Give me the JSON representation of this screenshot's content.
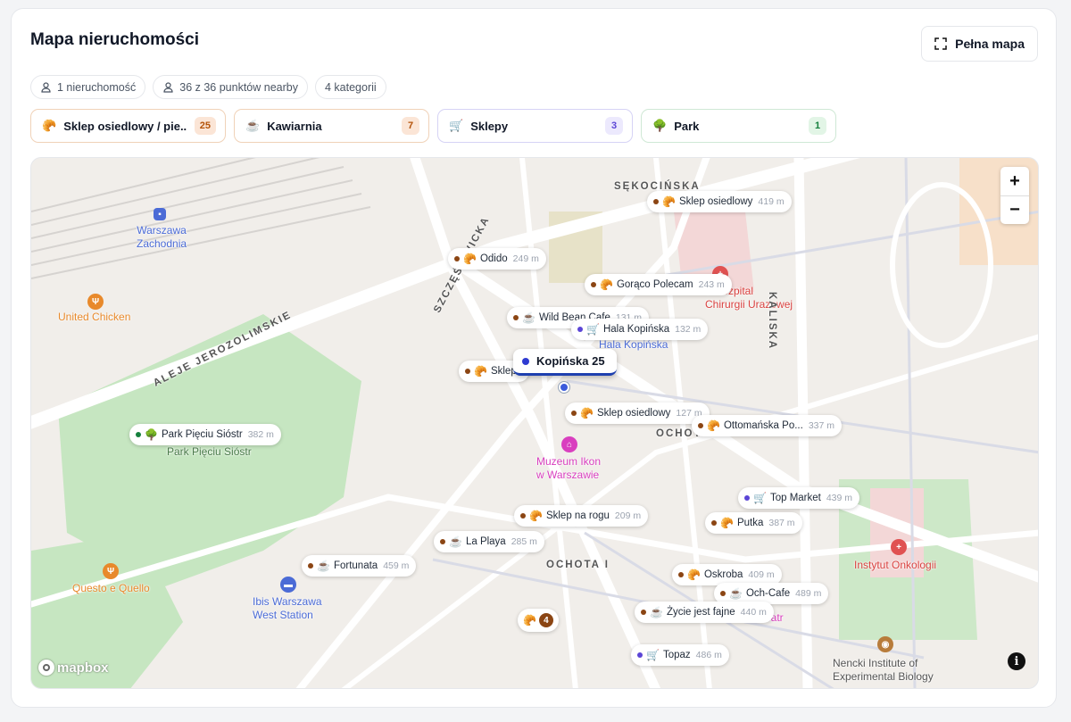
{
  "header": {
    "title": "Mapa nieruchomości",
    "full_map_label": "Pełna mapa",
    "full_map_icon": "expand-icon"
  },
  "pills": [
    {
      "icon": "person-pin-icon",
      "label": "1 nieruchomość"
    },
    {
      "icon": "person-pin-icon",
      "label": "36 z 36 punktów nearby"
    },
    {
      "label": "4 kategorii"
    }
  ],
  "categories": [
    {
      "icon": "🥐",
      "label": "Sklep osiedlowy / pie...",
      "count": "25",
      "border": "#f0d2b8",
      "badge_bg": "#fbe5d6",
      "badge_fg": "#b45309"
    },
    {
      "icon": "☕",
      "label": "Kawiarnia",
      "count": "7",
      "border": "#f0d2b8",
      "badge_bg": "#fbe5d6",
      "badge_fg": "#b45309"
    },
    {
      "icon": "🛒",
      "label": "Sklepy",
      "count": "3",
      "border": "#d6d3f5",
      "badge_bg": "#ece9fd",
      "badge_fg": "#5b45d6"
    },
    {
      "icon": "🌳",
      "label": "Park",
      "count": "1",
      "border": "#cfe8d5",
      "badge_bg": "#e2f5e6",
      "badge_fg": "#15803d"
    }
  ],
  "map": {
    "main_marker": "Kopińska 25",
    "cluster_count": "4",
    "cluster_icon": "🥐",
    "zoom_in": "+",
    "zoom_out": "−",
    "info": "i",
    "attribution": "mapbox",
    "places": [
      {
        "text": "Warszawa\nZachodnia",
        "color": "#4b6bd6"
      },
      {
        "text": "United Chicken",
        "color": "#e8892b"
      },
      {
        "text": "Park Pięciu Sióstr",
        "color": "#4a7a4a"
      },
      {
        "text": "Muzeum Ikon\nw Warszawie",
        "color": "#d93fbf"
      },
      {
        "text": "Questo e Quello",
        "color": "#e8892b"
      },
      {
        "text": "Ibis Warszawa\nWest Station",
        "color": "#4b6bd6"
      },
      {
        "text": "Instytut Onkologii",
        "color": "#d9413f"
      },
      {
        "text": "Nencki Institute of\nExperimental Biology",
        "color": "#555555"
      },
      {
        "text": "Hala Kopińska",
        "color": "#4b6bd6"
      },
      {
        "text": "cki Szpital\nChirurgii Urazowej",
        "color": "#d9413f"
      },
      {
        "text": "eatr",
        "color": "#d93fbf"
      }
    ],
    "streets": [
      "SĘKOCIŃSKA",
      "ALEJE JEROZOLIMSKIE",
      "SZCZĘŚLIWICKA",
      "KALISKA",
      "OCHOTA",
      "OCHOTA I"
    ],
    "markers": [
      {
        "icon": "🥐",
        "name": "Sklep osiedlowy",
        "dist": "419 m",
        "dot": "#8b4513"
      },
      {
        "icon": "🥐",
        "name": "Odido",
        "dist": "249 m",
        "dot": "#8b4513"
      },
      {
        "icon": "🥐",
        "name": "Gorąco Polecam",
        "dist": "243 m",
        "dot": "#8b4513"
      },
      {
        "icon": "☕",
        "name": "Wild Bean Cafe",
        "dist": "131 m",
        "dot": "#8b4513"
      },
      {
        "icon": "🛒",
        "name": "Hala Kopińska",
        "dist": "132 m",
        "dot": "#5b45d6"
      },
      {
        "icon": "🥐",
        "name": "Sklep",
        "dist": "",
        "dot": "#8b4513"
      },
      {
        "icon": "🥐",
        "name": "Sklep osiedlowy",
        "dist": "127 m",
        "dot": "#8b4513"
      },
      {
        "icon": "🥐",
        "name": "Ottomańska Po...",
        "dist": "337 m",
        "dot": "#8b4513"
      },
      {
        "icon": "🌳",
        "name": "Park Pięciu Sióstr",
        "dist": "382 m",
        "dot": "#15803d"
      },
      {
        "icon": "🛒",
        "name": "Top Market",
        "dist": "439 m",
        "dot": "#5b45d6"
      },
      {
        "icon": "🥐",
        "name": "Sklep na rogu",
        "dist": "209 m",
        "dot": "#8b4513"
      },
      {
        "icon": "🥐",
        "name": "Putka",
        "dist": "387 m",
        "dot": "#8b4513"
      },
      {
        "icon": "☕",
        "name": "La Playa",
        "dist": "285 m",
        "dot": "#8b4513"
      },
      {
        "icon": "☕",
        "name": "Fortunata",
        "dist": "459 m",
        "dot": "#8b4513"
      },
      {
        "icon": "🥐",
        "name": "Oskroba",
        "dist": "409 m",
        "dot": "#8b4513"
      },
      {
        "icon": "☕",
        "name": "Och-Cafe",
        "dist": "489 m",
        "dot": "#8b4513"
      },
      {
        "icon": "☕",
        "name": "Życie jest fajne",
        "dist": "440 m",
        "dot": "#8b4513"
      },
      {
        "icon": "🛒",
        "name": "Topaz",
        "dist": "486 m",
        "dot": "#5b45d6"
      }
    ]
  }
}
